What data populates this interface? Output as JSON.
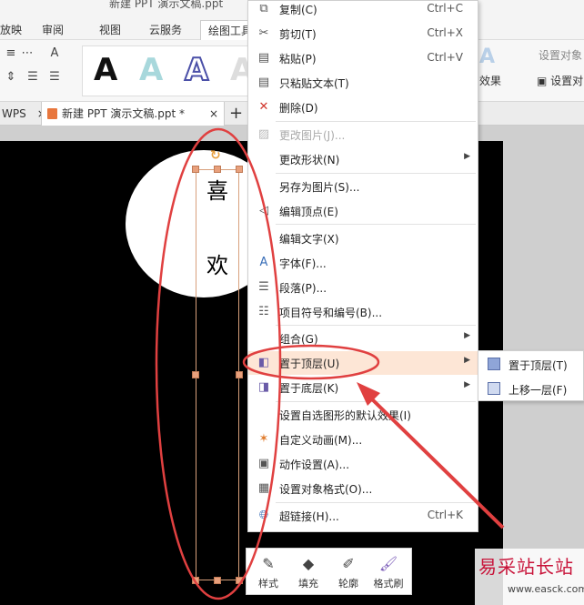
{
  "window": {
    "title": "新建 PPT 演示文稿.ppt"
  },
  "menu_tabs": [
    "放映",
    "审阅",
    "视图",
    "云服务",
    "绘图工具"
  ],
  "ribbon": {
    "right_group_label": "设置对象",
    "effects_label": "效果",
    "set_obj_label": "设置对",
    "art_letter": "A"
  },
  "doc_tabs": {
    "left_fragment": "WPS",
    "active": "新建 PPT 演示文稿.ppt *",
    "new_tab": "+"
  },
  "slide_text": [
    "喜",
    "欢"
  ],
  "context_menu": {
    "items": [
      {
        "label": "复制(C)",
        "shortcut": "Ctrl+C",
        "icon": "copy-icon"
      },
      {
        "label": "剪切(T)",
        "shortcut": "Ctrl+X",
        "icon": "scissors-icon"
      },
      {
        "label": "粘贴(P)",
        "shortcut": "Ctrl+V",
        "icon": "paste-icon"
      },
      {
        "label": "只粘贴文本(T)",
        "shortcut": "",
        "icon": "paste-text-icon"
      },
      {
        "label": "删除(D)",
        "shortcut": "",
        "icon": "delete-icon"
      },
      {
        "label": "更改图片(J)...",
        "shortcut": "",
        "icon": "change-picture-icon",
        "disabled": true
      },
      {
        "label": "更改形状(N)",
        "shortcut": "",
        "icon": "",
        "submenu": true
      },
      {
        "label": "另存为图片(S)...",
        "shortcut": "",
        "icon": ""
      },
      {
        "label": "编辑顶点(E)",
        "shortcut": "",
        "icon": "edit-points-icon"
      },
      {
        "label": "编辑文字(X)",
        "shortcut": "",
        "icon": ""
      },
      {
        "label": "字体(F)...",
        "shortcut": "",
        "icon": "font-icon"
      },
      {
        "label": "段落(P)...",
        "shortcut": "",
        "icon": "paragraph-icon"
      },
      {
        "label": "项目符号和编号(B)...",
        "shortcut": "",
        "icon": "bullets-icon"
      },
      {
        "label": "组合(G)",
        "shortcut": "",
        "icon": "",
        "submenu": true
      },
      {
        "label": "置于顶层(U)",
        "shortcut": "",
        "icon": "bring-to-front-icon",
        "submenu": true,
        "highlight": true
      },
      {
        "label": "置于底层(K)",
        "shortcut": "",
        "icon": "send-to-back-icon",
        "submenu": true
      },
      {
        "label": "设置自选图形的默认效果(I)",
        "shortcut": "",
        "icon": ""
      },
      {
        "label": "自定义动画(M)...",
        "shortcut": "",
        "icon": "animation-icon"
      },
      {
        "label": "动作设置(A)...",
        "shortcut": "",
        "icon": "action-icon"
      },
      {
        "label": "设置对象格式(O)...",
        "shortcut": "",
        "icon": "format-object-icon"
      },
      {
        "label": "超链接(H)...",
        "shortcut": "Ctrl+K",
        "icon": "hyperlink-icon"
      }
    ]
  },
  "submenu": {
    "items": [
      "置于顶层(T)",
      "上移一层(F)"
    ]
  },
  "mini_toolbar": [
    "样式",
    "填充",
    "轮廓",
    "格式刷"
  ],
  "watermark": {
    "main": "易采站长站",
    "sub": "www.easck.com"
  },
  "colors": {
    "highlight": "#fde6d6",
    "annotation_red": "#e04040",
    "watermark_red": "#c8143a"
  }
}
